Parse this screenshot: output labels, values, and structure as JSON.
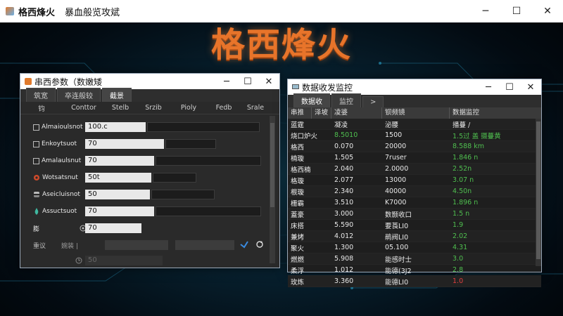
{
  "app": {
    "title": "格西烽火",
    "subtitle": "暴血般览攻斌",
    "hero_title": "格西烽火"
  },
  "window_params": {
    "title": "串西参数（数嫩矮",
    "tabs": [
      "筑宽",
      "卒连般较",
      "截景"
    ],
    "columns": [
      "钧",
      "Conttor",
      "Stelb",
      "Srzib",
      "Pioly",
      "Fedb",
      "Srale"
    ],
    "rows": [
      {
        "label": "Almaioulsnot",
        "value": "100.c",
        "icon": "checkbox"
      },
      {
        "label": "Enkoytsuot",
        "value": "70",
        "icon": "checkbox"
      },
      {
        "label": "Amalaulsnut",
        "value": "70",
        "icon": "checkbox"
      },
      {
        "label": "Wotsatsnut",
        "value": "50t",
        "icon": "gear-icon"
      },
      {
        "label": "Aseicluisnot",
        "value": "50",
        "icon": "stack-icon"
      },
      {
        "label": "Assuctsuot",
        "value": "70",
        "icon": "drop-icon"
      },
      {
        "label": "膨",
        "value": "70",
        "icon": "none"
      }
    ],
    "extra_row_label": "重议",
    "extra_row_text": "婉装 |",
    "extra_value": "50"
  },
  "window_monitor": {
    "title": "数据收发监控",
    "tabs": [
      "数据收",
      "监控",
      ">"
    ],
    "columns": [
      "串推",
      "泽坡",
      "凌婆",
      "钡频镜",
      "数据监控"
    ],
    "rows": [
      {
        "c1": "蓝霆",
        "c2": "凝凌",
        "c3": "泌腰",
        "c4": "播蔓 /",
        "color": "#e0e0e0"
      },
      {
        "c1": "烧口炉火",
        "c2": "8.5010",
        "c3": "1500",
        "c4": "1.5过 盖 摄蔓黄",
        "color": "#4fbf4f"
      },
      {
        "c1": "格西",
        "c2": "0.070",
        "c3": "20000",
        "c4": "8.588 km",
        "color": "#4fbf4f"
      },
      {
        "c1": "楠璇",
        "c2": "1.505",
        "c3": "7ruser",
        "c4": "1.846 n",
        "color": "#4fbf4f"
      },
      {
        "c1": "格西楠",
        "c2": "2.040",
        "c3": "2.0000",
        "c4": "2.52n",
        "color": "#4fbf4f"
      },
      {
        "c1": "格璇",
        "c2": "2.077",
        "c3": "13000",
        "c4": "3.07 n",
        "color": "#4fbf4f"
      },
      {
        "c1": "根璇",
        "c2": "2.340",
        "c3": "40000",
        "c4": "4.50n",
        "color": "#4fbf4f"
      },
      {
        "c1": "栅霸",
        "c2": "3.510",
        "c3": "K7000",
        "c4": "1.896 n",
        "color": "#4fbf4f"
      },
      {
        "c1": "蓋豪",
        "c2": "3.000",
        "c3": "数颢收口",
        "c4": "1.5 n",
        "color": "#4fbf4f"
      },
      {
        "c1": "床搭",
        "c2": "5.590",
        "c3": "要莨LI0",
        "c4": "1.9",
        "color": "#4fbf4f"
      },
      {
        "c1": "兼烤",
        "c2": "4.012",
        "c3": "鹃阀LI0",
        "c4": "2.02",
        "color": "#4fbf4f"
      },
      {
        "c1": "聚火",
        "c2": "1.300",
        "c3": "05.100",
        "c4": "4.31",
        "color": "#4fbf4f"
      },
      {
        "c1": "燃燃",
        "c2": "5.908",
        "c3": "能感时士",
        "c4": "3.0",
        "color": "#4fbf4f"
      },
      {
        "c1": "柔浮",
        "c2": "1.012",
        "c3": "能德(3J2",
        "c4": "2.8",
        "color": "#4fbf4f"
      },
      {
        "c1": "玫炼",
        "c2": "3.360",
        "c3": "能德LI0",
        "c4": "1.0",
        "color": "#e04040"
      }
    ]
  },
  "colors": {
    "accent_orange": "#e8742a",
    "value_green": "#4fbf4f",
    "value_red": "#e04040"
  }
}
